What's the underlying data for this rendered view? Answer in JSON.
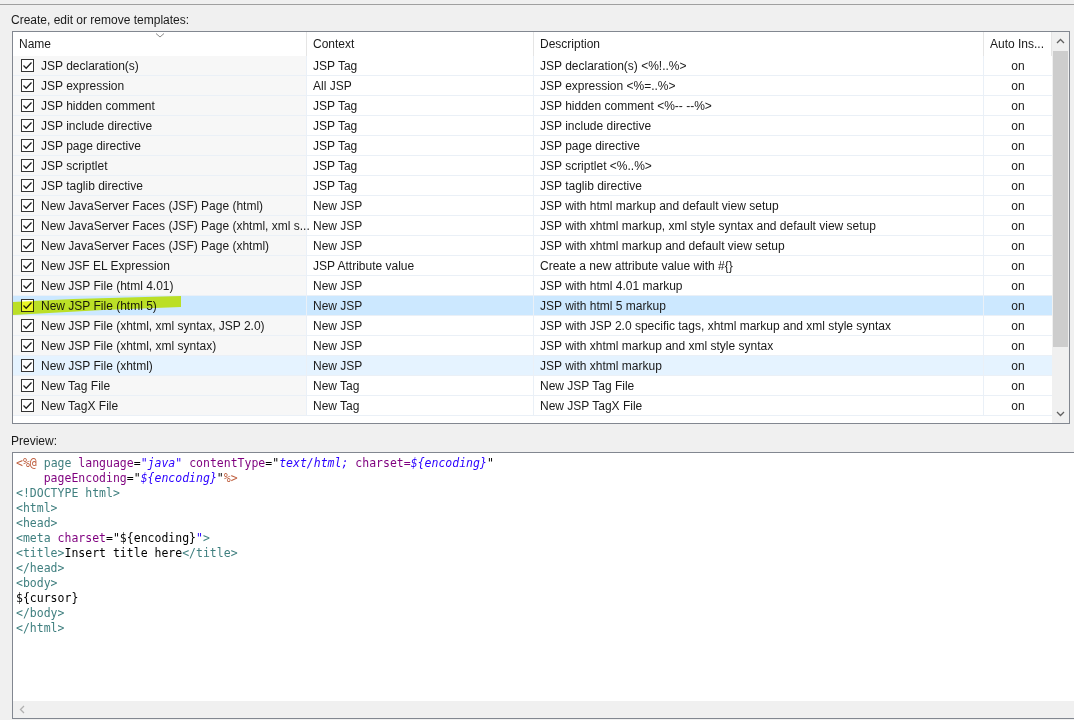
{
  "heading": "Create, edit or remove templates:",
  "table": {
    "columns": [
      {
        "label": "Name",
        "sorted": true
      },
      {
        "label": "Context",
        "sorted": false
      },
      {
        "label": "Description",
        "sorted": false
      },
      {
        "label": "Auto Ins...",
        "sorted": false
      }
    ],
    "rows": [
      {
        "name": "JSP declaration(s)",
        "context": "JSP Tag",
        "description": "JSP declaration(s) <%!..%>",
        "auto_insert": "on",
        "checked": true,
        "selected": false,
        "hovered": false,
        "highlighted": false
      },
      {
        "name": "JSP expression",
        "context": "All JSP",
        "description": "JSP expression <%=..%>",
        "auto_insert": "on",
        "checked": true,
        "selected": false,
        "hovered": false,
        "highlighted": false
      },
      {
        "name": "JSP hidden comment",
        "context": "JSP Tag",
        "description": "JSP hidden comment <%-- --%>",
        "auto_insert": "on",
        "checked": true,
        "selected": false,
        "hovered": false,
        "highlighted": false
      },
      {
        "name": "JSP include directive",
        "context": "JSP Tag",
        "description": "JSP include directive",
        "auto_insert": "on",
        "checked": true,
        "selected": false,
        "hovered": false,
        "highlighted": false
      },
      {
        "name": "JSP page directive",
        "context": "JSP Tag",
        "description": "JSP page directive",
        "auto_insert": "on",
        "checked": true,
        "selected": false,
        "hovered": false,
        "highlighted": false
      },
      {
        "name": "JSP scriptlet",
        "context": "JSP Tag",
        "description": "JSP scriptlet <%..%>",
        "auto_insert": "on",
        "checked": true,
        "selected": false,
        "hovered": false,
        "highlighted": false
      },
      {
        "name": "JSP taglib directive",
        "context": "JSP Tag",
        "description": "JSP taglib directive",
        "auto_insert": "on",
        "checked": true,
        "selected": false,
        "hovered": false,
        "highlighted": false
      },
      {
        "name": "New JavaServer Faces (JSF) Page (html)",
        "context": "New JSP",
        "description": "JSP with html markup and default view setup",
        "auto_insert": "on",
        "checked": true,
        "selected": false,
        "hovered": false,
        "highlighted": false
      },
      {
        "name": "New JavaServer Faces (JSF) Page (xhtml, xml s...",
        "context": "New JSP",
        "description": "JSP with xhtml markup, xml style syntax and default view setup",
        "auto_insert": "on",
        "checked": true,
        "selected": false,
        "hovered": false,
        "highlighted": false
      },
      {
        "name": "New JavaServer Faces (JSF) Page (xhtml)",
        "context": "New JSP",
        "description": "JSP with xhtml markup and default view setup",
        "auto_insert": "on",
        "checked": true,
        "selected": false,
        "hovered": false,
        "highlighted": false
      },
      {
        "name": "New JSF EL Expression",
        "context": "JSP Attribute value",
        "description": "Create a new attribute value with #{}",
        "auto_insert": "on",
        "checked": true,
        "selected": false,
        "hovered": false,
        "highlighted": false
      },
      {
        "name": "New JSP File (html 4.01)",
        "context": "New JSP",
        "description": "JSP with html 4.01 markup",
        "auto_insert": "on",
        "checked": true,
        "selected": false,
        "hovered": false,
        "highlighted": false
      },
      {
        "name": "New JSP File (html 5)",
        "context": "New JSP",
        "description": "JSP with html 5 markup",
        "auto_insert": "on",
        "checked": true,
        "selected": true,
        "hovered": false,
        "highlighted": true
      },
      {
        "name": "New JSP File (xhtml, xml syntax, JSP 2.0)",
        "context": "New JSP",
        "description": "JSP with JSP 2.0 specific tags, xhtml markup and xml style syntax",
        "auto_insert": "on",
        "checked": true,
        "selected": false,
        "hovered": false,
        "highlighted": false
      },
      {
        "name": "New JSP File (xhtml, xml syntax)",
        "context": "New JSP",
        "description": "JSP with xhtml markup and xml style syntax",
        "auto_insert": "on",
        "checked": true,
        "selected": false,
        "hovered": false,
        "highlighted": false
      },
      {
        "name": "New JSP File (xhtml)",
        "context": "New JSP",
        "description": "JSP with xhtml markup",
        "auto_insert": "on",
        "checked": true,
        "selected": false,
        "hovered": true,
        "highlighted": false
      },
      {
        "name": "New Tag File",
        "context": "New Tag",
        "description": "New JSP Tag File",
        "auto_insert": "on",
        "checked": true,
        "selected": false,
        "hovered": false,
        "highlighted": false
      },
      {
        "name": "New TagX File",
        "context": "New Tag",
        "description": "New JSP TagX File",
        "auto_insert": "on",
        "checked": true,
        "selected": false,
        "hovered": false,
        "highlighted": false
      }
    ]
  },
  "preview": {
    "label": "Preview:",
    "lines": [
      [
        {
          "kind": "delim",
          "text": "<%@"
        },
        {
          "kind": "tag",
          "text": " page"
        },
        {
          "kind": "attr",
          "text": " language"
        },
        {
          "kind": "text",
          "text": "="
        },
        {
          "kind": "value",
          "text": "\"java\""
        },
        {
          "kind": "attr",
          "text": " contentType"
        },
        {
          "kind": "text",
          "text": "=\""
        },
        {
          "kind": "value",
          "text": "text/html; "
        },
        {
          "kind": "attr",
          "text": "charset="
        },
        {
          "kind": "value",
          "text": "${encoding}"
        },
        {
          "kind": "text",
          "text": "\""
        }
      ],
      [
        {
          "kind": "attr",
          "text": "    pageEncoding"
        },
        {
          "kind": "text",
          "text": "=\""
        },
        {
          "kind": "value",
          "text": "${encoding}"
        },
        {
          "kind": "text",
          "text": "\""
        },
        {
          "kind": "delim",
          "text": "%>"
        }
      ],
      [
        {
          "kind": "tag",
          "text": "<!DOCTYPE html>"
        }
      ],
      [
        {
          "kind": "tag",
          "text": "<html>"
        }
      ],
      [
        {
          "kind": "tag",
          "text": "<head>"
        }
      ],
      [
        {
          "kind": "tag",
          "text": "<meta"
        },
        {
          "kind": "attr",
          "text": " charset"
        },
        {
          "kind": "text",
          "text": "=\"${encoding}"
        },
        {
          "kind": "value",
          "text": "\""
        },
        {
          "kind": "tag",
          "text": ">"
        }
      ],
      [
        {
          "kind": "tag",
          "text": "<title>"
        },
        {
          "kind": "text",
          "text": "Insert title here"
        },
        {
          "kind": "tag",
          "text": "</title>"
        }
      ],
      [
        {
          "kind": "tag",
          "text": "</head>"
        }
      ],
      [
        {
          "kind": "tag",
          "text": "<body>"
        }
      ],
      [
        {
          "kind": "text",
          "text": "${cursor}"
        }
      ],
      [
        {
          "kind": "tag",
          "text": "</body>"
        }
      ],
      [
        {
          "kind": "tag",
          "text": "</html>"
        }
      ]
    ]
  }
}
